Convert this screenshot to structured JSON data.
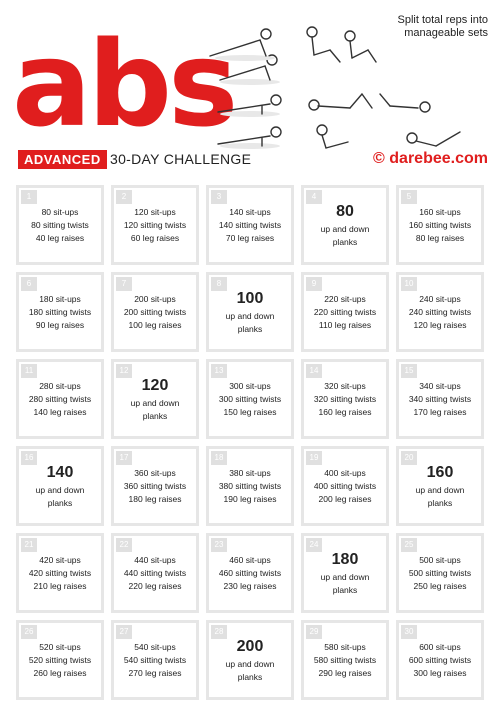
{
  "header": {
    "title": "abs",
    "badge": "ADVANCED",
    "subtitle": "30-DAY CHALLENGE",
    "brand": "© darebee.com",
    "note": "Split total reps into manageable sets"
  },
  "days": [
    {
      "day": "1",
      "lines": [
        "80 sit-ups",
        "80 sitting twists",
        "40 leg raises"
      ]
    },
    {
      "day": "2",
      "lines": [
        "120 sit-ups",
        "120 sitting twists",
        "60 leg raises"
      ]
    },
    {
      "day": "3",
      "lines": [
        "140 sit-ups",
        "140 sitting twists",
        "70 leg raises"
      ]
    },
    {
      "day": "4",
      "big": "80",
      "sub": "up and down planks"
    },
    {
      "day": "5",
      "lines": [
        "160 sit-ups",
        "160 sitting twists",
        "80 leg raises"
      ]
    },
    {
      "day": "6",
      "lines": [
        "180 sit-ups",
        "180 sitting twists",
        "90 leg raises"
      ]
    },
    {
      "day": "7",
      "lines": [
        "200 sit-ups",
        "200 sitting twists",
        "100 leg raises"
      ]
    },
    {
      "day": "8",
      "big": "100",
      "sub": "up and down planks"
    },
    {
      "day": "9",
      "lines": [
        "220 sit-ups",
        "220 sitting twists",
        "110 leg raises"
      ]
    },
    {
      "day": "10",
      "lines": [
        "240 sit-ups",
        "240 sitting twists",
        "120 leg raises"
      ]
    },
    {
      "day": "11",
      "lines": [
        "280 sit-ups",
        "280 sitting twists",
        "140 leg raises"
      ]
    },
    {
      "day": "12",
      "big": "120",
      "sub": "up and down planks"
    },
    {
      "day": "13",
      "lines": [
        "300 sit-ups",
        "300 sitting twists",
        "150 leg raises"
      ]
    },
    {
      "day": "14",
      "lines": [
        "320 sit-ups",
        "320 sitting twists",
        "160 leg raises"
      ]
    },
    {
      "day": "15",
      "lines": [
        "340 sit-ups",
        "340 sitting twists",
        "170 leg raises"
      ]
    },
    {
      "day": "16",
      "big": "140",
      "sub": "up and down planks"
    },
    {
      "day": "17",
      "lines": [
        "360 sit-ups",
        "360 sitting twists",
        "180 leg raises"
      ]
    },
    {
      "day": "18",
      "lines": [
        "380 sit-ups",
        "380 sitting twists",
        "190 leg raises"
      ]
    },
    {
      "day": "19",
      "lines": [
        "400 sit-ups",
        "400 sitting twists",
        "200 leg raises"
      ]
    },
    {
      "day": "20",
      "big": "160",
      "sub": "up and down planks"
    },
    {
      "day": "21",
      "lines": [
        "420 sit-ups",
        "420 sitting twists",
        "210 leg raises"
      ]
    },
    {
      "day": "22",
      "lines": [
        "440 sit-ups",
        "440 sitting twists",
        "220 leg raises"
      ]
    },
    {
      "day": "23",
      "lines": [
        "460 sit-ups",
        "460 sitting twists",
        "230 leg raises"
      ]
    },
    {
      "day": "24",
      "big": "180",
      "sub": "up and down planks"
    },
    {
      "day": "25",
      "lines": [
        "500 sit-ups",
        "500 sitting twists",
        "250 leg raises"
      ]
    },
    {
      "day": "26",
      "lines": [
        "520 sit-ups",
        "520 sitting twists",
        "260 leg raises"
      ]
    },
    {
      "day": "27",
      "lines": [
        "540 sit-ups",
        "540 sitting twists",
        "270 leg raises"
      ]
    },
    {
      "day": "28",
      "big": "200",
      "sub": "up and down planks"
    },
    {
      "day": "29",
      "lines": [
        "580 sit-ups",
        "580 sitting twists",
        "290 leg raises"
      ]
    },
    {
      "day": "30",
      "lines": [
        "600 sit-ups",
        "600 sitting twists",
        "300 leg raises"
      ]
    }
  ]
}
